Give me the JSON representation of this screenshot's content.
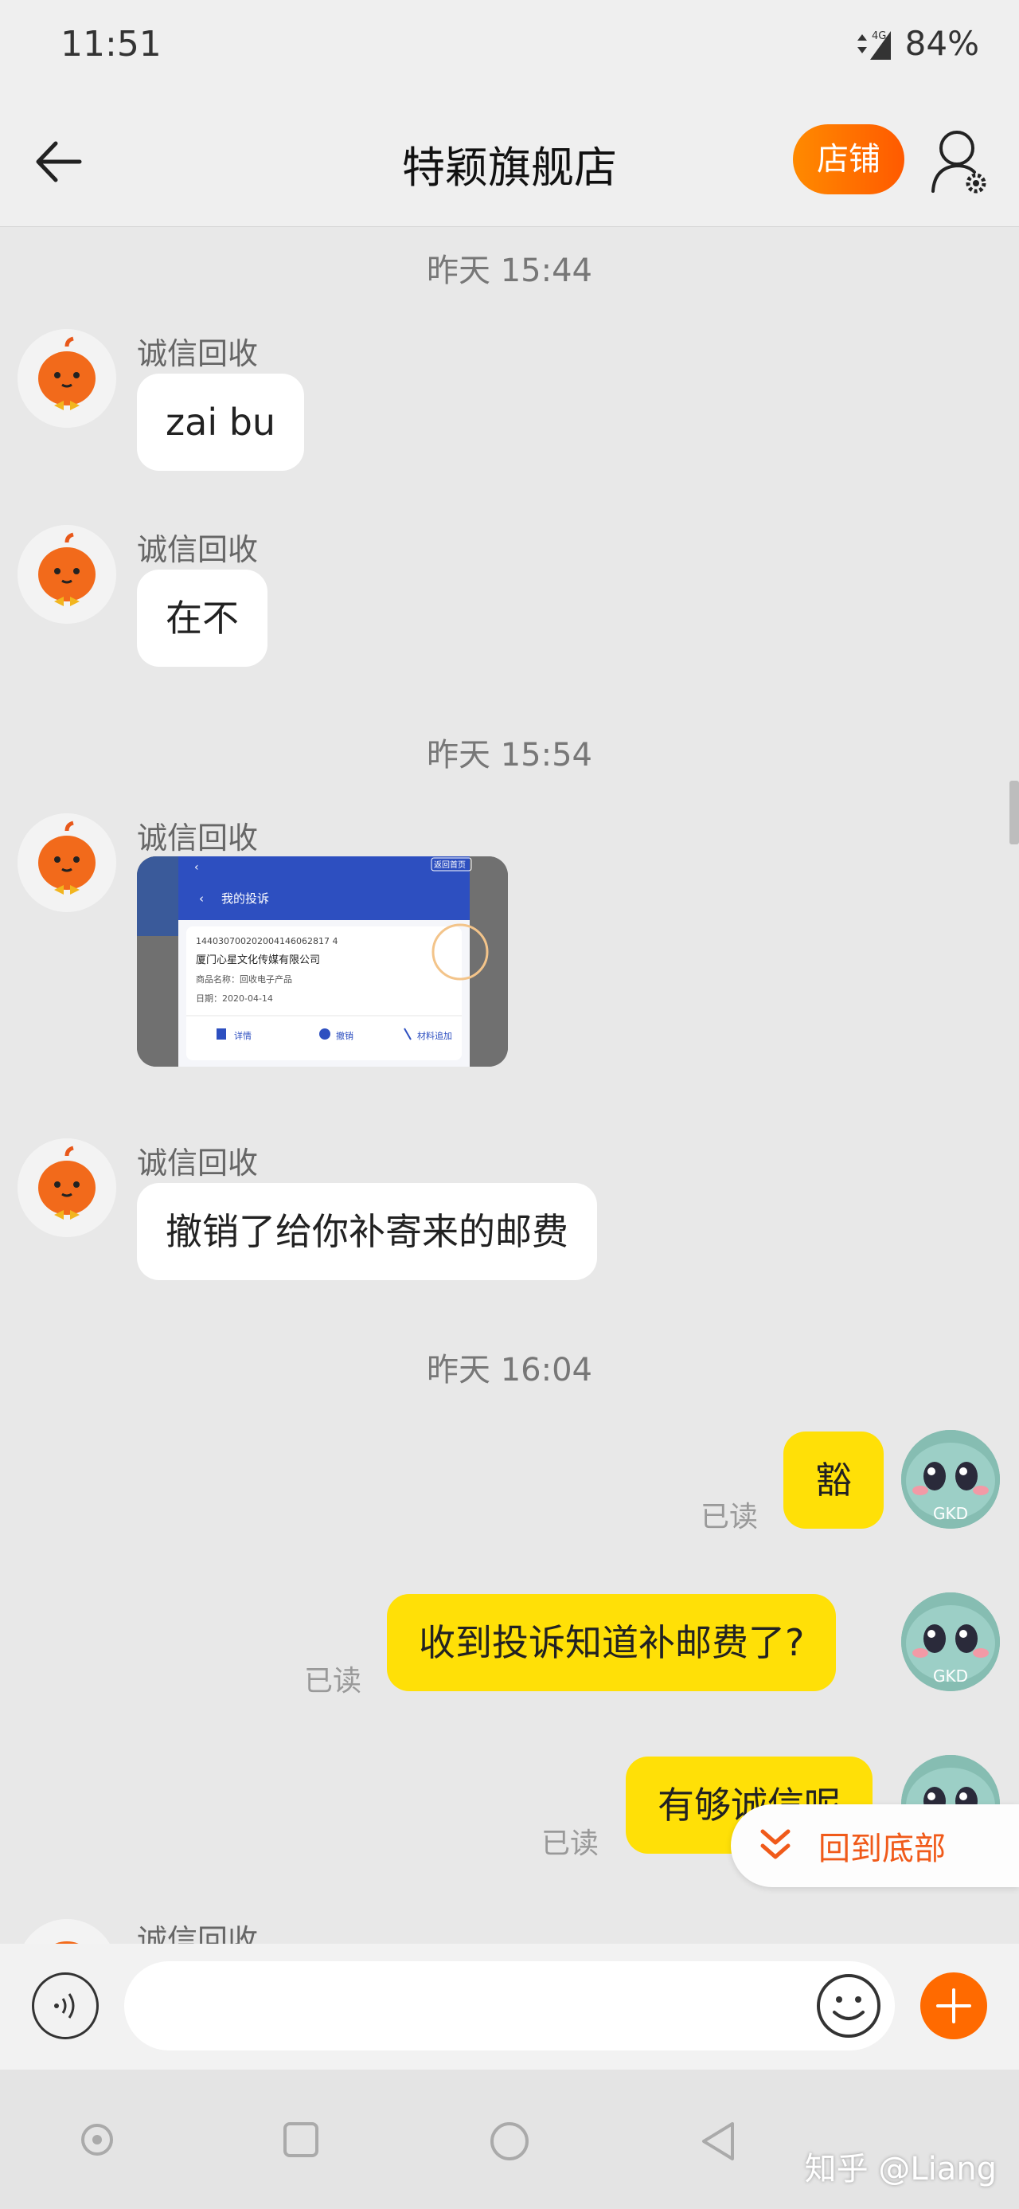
{
  "status": {
    "time": "11:51",
    "signal": "4G",
    "battery": "84%"
  },
  "header": {
    "title": "特颖旗舰店",
    "shop_button": "店铺"
  },
  "messages": {
    "t1": "昨天 15:44",
    "m1": {
      "sender": "诚信回收",
      "text": "zai bu"
    },
    "m2": {
      "sender": "诚信回收",
      "text": "在不"
    },
    "t2": "昨天 15:54",
    "m3": {
      "sender": "诚信回收",
      "image": {
        "back_home": "返回首页",
        "title": "我的投诉",
        "number": "144030700202004146062817 4",
        "company": "厦门心星文化传媒有限公司",
        "product": "商品名称：回收电子产品",
        "date": "日期：2020-04-14",
        "actions": [
          "详情",
          "撤销",
          "材料追加"
        ]
      }
    },
    "m4": {
      "sender": "诚信回收",
      "text": "撤销了给你补寄来的邮费"
    },
    "t3": "昨天 16:04",
    "o1": {
      "text": "豁",
      "status": "已读",
      "avatar_label": "GKD"
    },
    "o2": {
      "text": "收到投诉知道补邮费了?",
      "status": "已读",
      "avatar_label": "GKD"
    },
    "o3": {
      "text": "有够诚信呢",
      "status": "已读"
    },
    "m5": {
      "sender": "诚信回收"
    }
  },
  "back_to_bottom": "回到底部",
  "input": {
    "placeholder": ""
  },
  "watermark": "知乎 @Liang",
  "colors": {
    "accent": "#ff6a00",
    "bubble_out": "#ffe007",
    "bubble_in": "#ffffff"
  }
}
